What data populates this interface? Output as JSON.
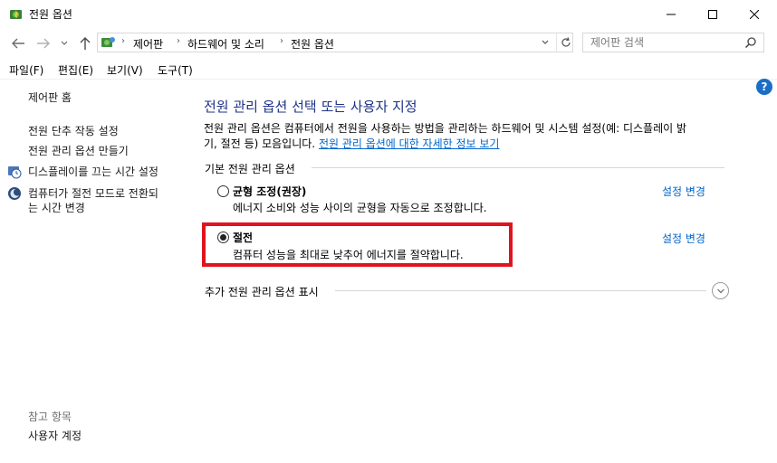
{
  "window": {
    "title": "전원 옵션"
  },
  "address_bar": {
    "crumbs": [
      "제어판",
      "하드웨어 및 소리",
      "전원 옵션"
    ]
  },
  "search": {
    "placeholder": "제어판 검색"
  },
  "menu": {
    "items": [
      "파일(F)",
      "편집(E)",
      "보기(V)",
      "도구(T)"
    ]
  },
  "sidebar": {
    "home": "제어판 홈",
    "links": [
      "전원 단추 작동 설정",
      "전원 관리 옵션 만들기",
      "디스플레이를 끄는 시간 설정",
      "컴퓨터가 절전 모드로 전환되",
      "는 시간 변경"
    ],
    "see_also_title": "참고 항목",
    "see_also_items": [
      "사용자 계정"
    ]
  },
  "main": {
    "title": "전원 관리 옵션 선택 또는 사용자 지정",
    "description_line1": "전원 관리 옵션은 컴퓨터에서 전원을 사용하는 방법을 관리하는 하드웨어 및 시스템 설정(예: 디스플레이 밝",
    "description_line2": "기, 절전 등) 모음입니다. ",
    "description_link": "전원 관리 옵션에 대한 자세한 정보 보기",
    "group_label": "기본 전원 관리 옵션",
    "plans": [
      {
        "name": "균형 조정(권장)",
        "description": "에너지 소비와 성능 사이의 균형을 자동으로 조정합니다.",
        "change_label": "설정 변경",
        "selected": false
      },
      {
        "name": "절전",
        "description": "컴퓨터 성능을 최대로 낮추어 에너지를 절약합니다.",
        "change_label": "설정 변경",
        "selected": true
      }
    ],
    "more_label": "추가 전원 관리 옵션 표시"
  },
  "colors": {
    "title_blue": "#1e3287",
    "link_blue": "#0066cc",
    "highlight_red": "#e0141e"
  },
  "help": {
    "label": "?"
  }
}
